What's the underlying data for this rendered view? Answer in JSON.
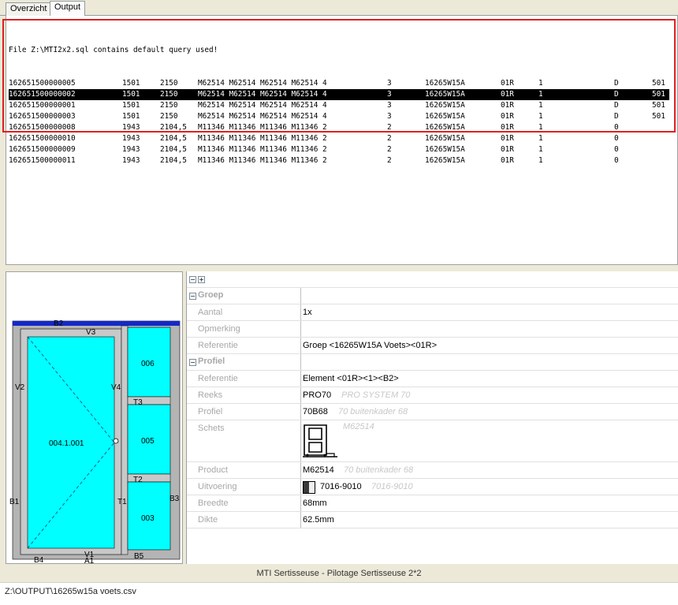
{
  "tabs": [
    {
      "label": "Overzicht",
      "active": false
    },
    {
      "label": "Output",
      "active": true
    }
  ],
  "output": {
    "header": "File Z:\\MTI2x2.sql contains default query used!",
    "rows": [
      [
        "162651500000005",
        "1501",
        "2150",
        "M62514 M62514 M62514 M62514 4",
        "3",
        "16265W15A",
        "01R",
        "1",
        "D",
        "501"
      ],
      [
        "162651500000002",
        "1501",
        "2150",
        "M62514 M62514 M62514 M62514 4",
        "3",
        "16265W15A",
        "01R",
        "1",
        "D",
        "501"
      ],
      [
        "162651500000001",
        "1501",
        "2150",
        "M62514 M62514 M62514 M62514 4",
        "3",
        "16265W15A",
        "01R",
        "1",
        "D",
        "501"
      ],
      [
        "162651500000003",
        "1501",
        "2150",
        "M62514 M62514 M62514 M62514 4",
        "3",
        "16265W15A",
        "01R",
        "1",
        "D",
        "501"
      ],
      [
        "162651500000008",
        "1943",
        "2104,5",
        "M11346 M11346 M11346 M11346 2",
        "2",
        "16265W15A",
        "01R",
        "1",
        "0",
        ""
      ],
      [
        "162651500000010",
        "1943",
        "2104,5",
        "M11346 M11346 M11346 M11346 2",
        "2",
        "16265W15A",
        "01R",
        "1",
        "0",
        ""
      ],
      [
        "162651500000009",
        "1943",
        "2104,5",
        "M11346 M11346 M11346 M11346 2",
        "2",
        "16265W15A",
        "01R",
        "1",
        "0",
        ""
      ],
      [
        "162651500000011",
        "1943",
        "2104,5",
        "M11346 M11346 M11346 M11346 2",
        "2",
        "16265W15A",
        "01R",
        "1",
        "0",
        ""
      ]
    ],
    "selected_row": 1
  },
  "drawing": {
    "labels": {
      "b2": "B2",
      "v3": "V3",
      "v2": "V2",
      "v4": "V4",
      "b1": "B1",
      "t1": "T1",
      "b3": "B3",
      "sash": "004.1.001",
      "p006": "006",
      "p005": "005",
      "p003": "003",
      "t3": "T3",
      "t2": "T2",
      "v1": "V1",
      "a1": "A1",
      "b4": "B4",
      "b5": "B5"
    },
    "colors": {
      "glass": "#00ffff",
      "frame": "#b4b4b4",
      "top_bar": "#1428c8"
    }
  },
  "props": {
    "expanders": [
      "−",
      "+"
    ],
    "groep": {
      "title": "Groep",
      "aantal_label": "Aantal",
      "aantal_value": "1x",
      "opmerking_label": "Opmerking",
      "referentie_label": "Referentie",
      "referentie_value": "Groep <16265W15A Voets><01R>"
    },
    "profiel": {
      "title": "Profiel",
      "referentie_label": "Referentie",
      "referentie_value": "Element <01R><1><B2>",
      "reeks_label": "Reeks",
      "reeks_value": "PRO70",
      "reeks_desc": "PRO SYSTEM 70",
      "profiel_label": "Profiel",
      "profiel_value": "70B68",
      "profiel_desc": "70 buitenkader 68",
      "schets_label": "Schets",
      "schets_desc": "M62514",
      "product_label": "Product",
      "product_value": "M62514",
      "product_desc": "70 buitenkader 68",
      "uitvoering_label": "Uitvoering",
      "uitvoering_value": "7016-9010",
      "uitvoering_desc": "7016-9010",
      "breedte_label": "Breedte",
      "breedte_value": "68mm",
      "dikte_label": "Dikte",
      "dikte_value": "62.5mm"
    }
  },
  "status": {
    "title": "MTI Sertisseuse - Pilotage Sertisseuse 2*2",
    "path": "Z:\\OUTPUT\\16265w15a voets.csv"
  }
}
